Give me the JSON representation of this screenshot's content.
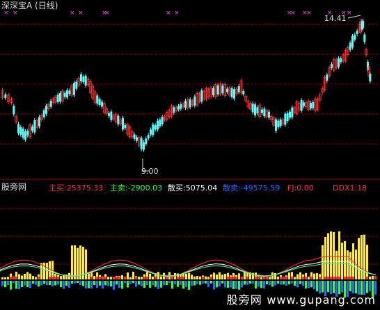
{
  "main_panel": {
    "title": "深深宝A (日线)",
    "high_label": "14.41",
    "low_label": "9.00"
  },
  "indicator_panel": {
    "title": "股旁网",
    "items": [
      {
        "label": "主买:",
        "value": "25375.33",
        "color": "#ff3333"
      },
      {
        "label": "主卖:",
        "value": "-2900.03",
        "color": "#33ff33"
      },
      {
        "label": "散买:",
        "value": "5075.04",
        "color": "#ffffff"
      },
      {
        "label": "散卖:",
        "value": "-49575.59",
        "color": "#3366ff"
      },
      {
        "label": "FJ:",
        "value": "0.00",
        "color": "#ff3333"
      },
      {
        "label": "DDX1:",
        "value": "18",
        "color": "#ff3333"
      }
    ]
  },
  "watermark": {
    "cn": "股旁网",
    "url": "www.gupang.com"
  },
  "colors": {
    "up": "#ff3333",
    "down": "#54ffff",
    "grid": "#8b0000",
    "marker": "#ff33ff"
  }
}
